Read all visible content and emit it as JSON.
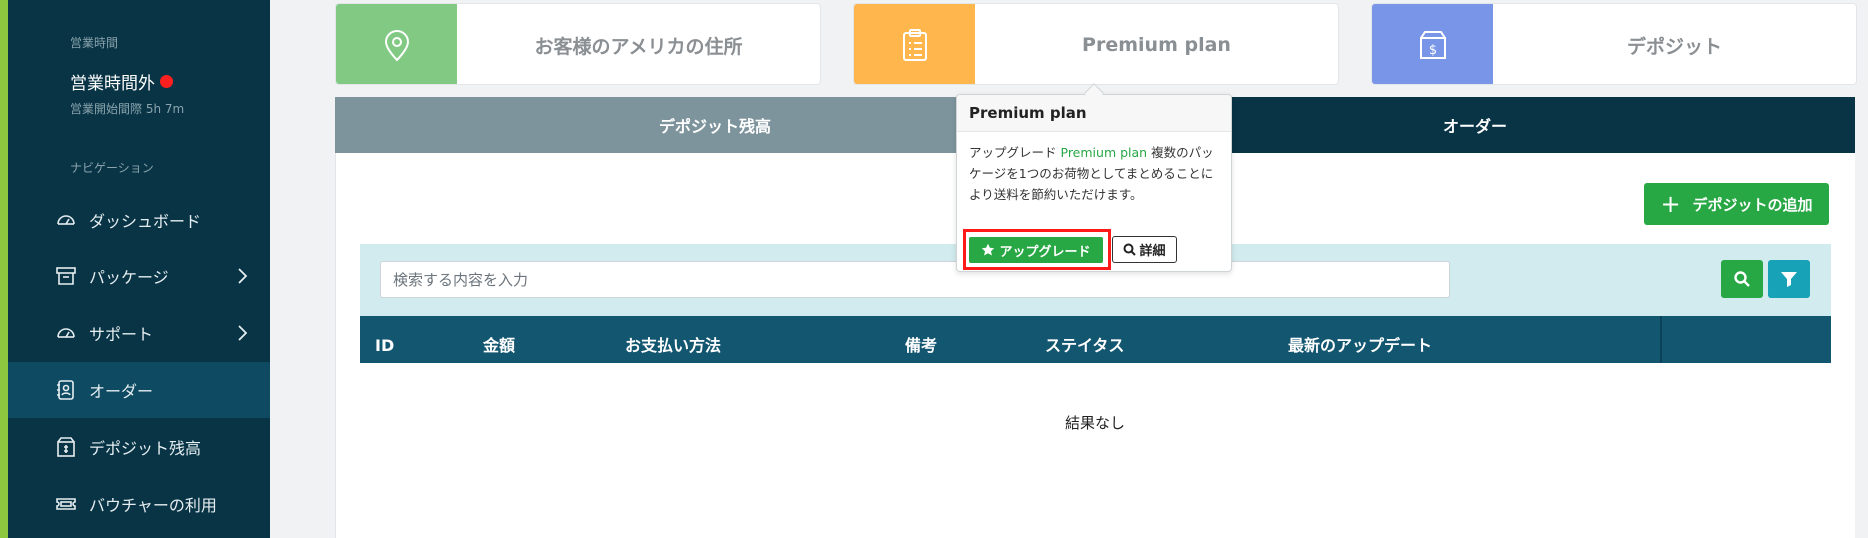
{
  "sidebar": {
    "hours_label": "営業時間",
    "status": "営業時間外",
    "status_sub": "営業開始間際 5h 7m",
    "nav_label": "ナビゲーション",
    "items": [
      {
        "label": "ダッシュボード",
        "icon": "gauge-icon"
      },
      {
        "label": "パッケージ",
        "icon": "archive-icon"
      },
      {
        "label": "サポート",
        "icon": "gauge-icon"
      },
      {
        "label": "オーダー",
        "icon": "contact-book-icon"
      },
      {
        "label": "デポジット残高",
        "icon": "deposit-box-icon"
      },
      {
        "label": "バウチャーの利用",
        "icon": "ticket-icon"
      }
    ]
  },
  "cards": [
    {
      "title": "お客様のアメリカの住所",
      "icon": "location-pin-icon",
      "color": "#82c984"
    },
    {
      "title": "Premium plan",
      "icon": "clipboard-list-icon",
      "color": "#ffb74d"
    },
    {
      "title": "デポジット",
      "icon": "dollar-box-icon",
      "color": "#7895e8"
    }
  ],
  "tabs": {
    "deposit": "デポジット残高",
    "order": "オーダー"
  },
  "popover": {
    "title": "Premium plan",
    "body_prefix": "アップグレード",
    "body_highlight": "Premium plan",
    "body_suffix": "複数のパッケージを1つのお荷物としてまとめることにより送料を節約いただけます。",
    "upgrade_label": "アップグレード",
    "detail_label": "詳細"
  },
  "toolbar": {
    "add_deposit_label": "デポジットの追加",
    "search_placeholder": "検索する内容を入力"
  },
  "table": {
    "columns": [
      "ID",
      "金額",
      "お支払い方法",
      "備考",
      "ステイタス",
      "最新のアップデート"
    ],
    "empty_text": "結果なし"
  },
  "colors": {
    "sidebar_bg": "#083445",
    "accent_green": "#28a745",
    "table_header": "#135670",
    "tab_inactive": "#7e949d",
    "tab_active": "#083445",
    "filter_btn": "#17a2b8"
  }
}
